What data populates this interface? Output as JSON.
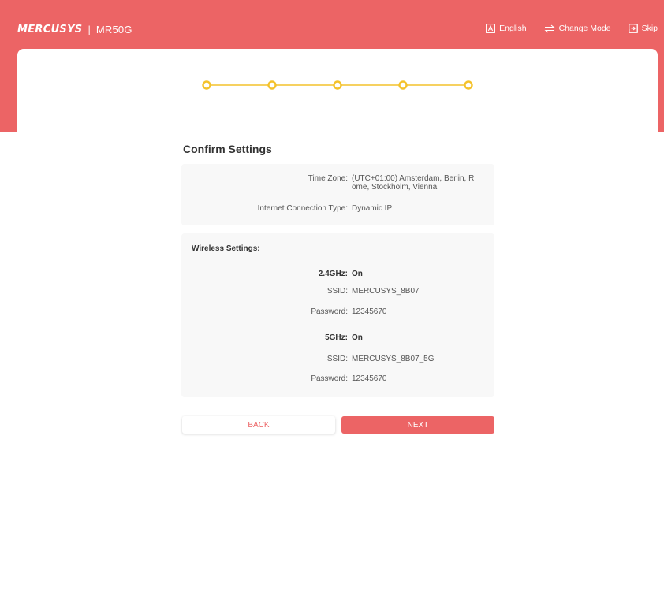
{
  "header": {
    "brand_logo": "MERCUSYS",
    "brand_separator": "|",
    "brand_model": "MR50G",
    "actions": {
      "language": {
        "label": "English",
        "icon": "language-icon"
      },
      "change_mode": {
        "label": "Change Mode",
        "icon": "change-mode-icon"
      },
      "skip": {
        "label": "Skip",
        "icon": "skip-icon"
      }
    }
  },
  "stepper": {
    "total_steps": 5,
    "completed_steps": 5
  },
  "page": {
    "title": "Confirm Settings"
  },
  "general": {
    "time_zone_label": "Time Zone:",
    "time_zone_line1": "(UTC+01:00) Amsterdam, Berlin, R",
    "time_zone_line2": "ome, Stockholm, Vienna",
    "connection_type_label": "Internet Connection Type:",
    "connection_type_value": "Dynamic IP"
  },
  "wireless": {
    "title": "Wireless Settings:",
    "band_24": {
      "label": "2.4GHz:",
      "status": "On",
      "ssid_label": "SSID:",
      "ssid": "MERCUSYS_8B07",
      "password_label": "Password:",
      "password": "12345670"
    },
    "band_5": {
      "label": "5GHz:",
      "status": "On",
      "ssid_label": "SSID:",
      "ssid": "MERCUSYS_8B07_5G",
      "password_label": "Password:",
      "password": "12345670"
    }
  },
  "buttons": {
    "back": "BACK",
    "next": "NEXT"
  },
  "colors": {
    "brand": "#ec6465",
    "stepper": "#f4c22b",
    "section_bg": "#f8f8f8",
    "text": "#555555"
  }
}
